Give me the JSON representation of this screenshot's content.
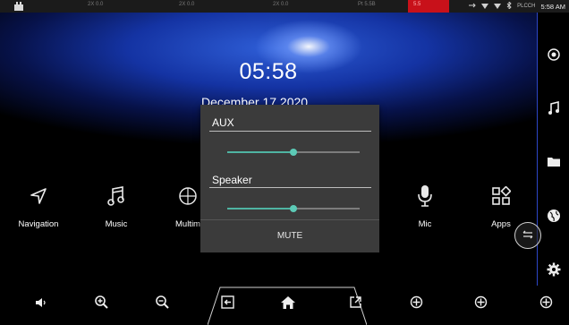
{
  "statusbar": {
    "segments": [
      "2X 0.0",
      "2X 0.0",
      "2X 0.0",
      "Pt 5.5B",
      "5.5"
    ],
    "right_small": "PLCCH",
    "time": "5:58 AM"
  },
  "home": {
    "clock": "05:58",
    "date": "December 17 2020"
  },
  "apps": [
    {
      "label": "Navigation",
      "icon": "navigation-arrow-icon"
    },
    {
      "label": "Music",
      "icon": "music-note-icon"
    },
    {
      "label": "Multim",
      "icon": "multimedia-icon"
    },
    {
      "label": "Mic",
      "icon": "microphone-icon"
    },
    {
      "label": "Apps",
      "icon": "apps-grid-icon"
    }
  ],
  "volume_dialog": {
    "aux_label": "AUX",
    "aux_level": 0.5,
    "speaker_label": "Speaker",
    "speaker_level": 0.5,
    "mute_label": "MUTE"
  },
  "sidebar": [
    "location-target-icon",
    "music-note-icon",
    "folder-icon",
    "globe-icon",
    "settings-gear-icon"
  ],
  "bottombar": [
    "volume-icon",
    "zoom-in-icon",
    "zoom-out-icon",
    "back-icon",
    "home-icon",
    "open-external-icon",
    "crosshair-plus-icon",
    "crosshair-plus-icon",
    "crosshair-plus-icon"
  ],
  "colors": {
    "accent": "#5ccab6",
    "sidebar_border": "#2d46c7",
    "status_red": "#c8111a"
  }
}
